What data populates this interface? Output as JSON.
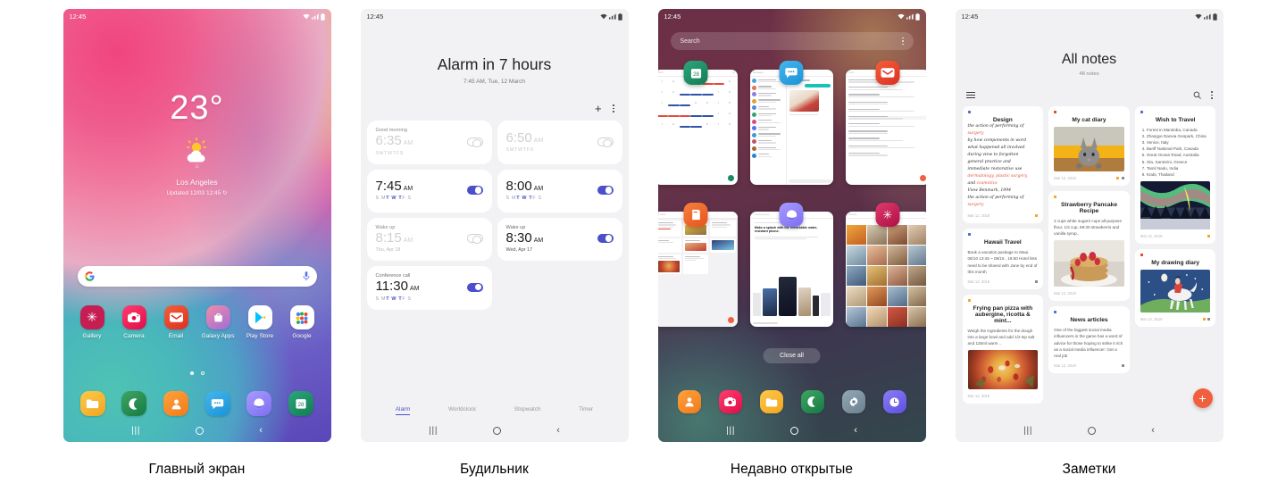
{
  "panels": [
    {
      "caption": "Главный экран"
    },
    {
      "caption": "Будильник"
    },
    {
      "caption": "Недавно открытые"
    },
    {
      "caption": "Заметки"
    }
  ],
  "status": {
    "time": "12:45"
  },
  "home": {
    "weather": {
      "temp": "23°",
      "pin": "⌂",
      "city": "Los Angeles",
      "updated": "Updated 12/03 12:45 ↻"
    },
    "search": {
      "placeholder": "",
      "logo": "G",
      "mic": "mic-icon"
    },
    "apps": [
      {
        "label": "Gallery",
        "glyph": "✳",
        "color": "#c51e53"
      },
      {
        "label": "Camera",
        "glyph": "◉",
        "color": "#e81c4f"
      },
      {
        "label": "Email",
        "glyph": "✉",
        "color": "#e8462c"
      },
      {
        "label": "Galaxy Apps",
        "glyph": "⬤",
        "color": "#e05a86"
      },
      {
        "label": "Play Store",
        "glyph": "▶",
        "color": "#ffffff"
      },
      {
        "label": "Google",
        "glyph": "⋮⋮",
        "color": "#ffffff"
      }
    ],
    "dots": {
      "active": 0,
      "count": 2
    },
    "dock": [
      {
        "label": "My Files",
        "glyph": "▭",
        "color": "#f5b431"
      },
      {
        "label": "Phone",
        "glyph": "✆",
        "color": "#2f8a4e"
      },
      {
        "label": "Contacts",
        "glyph": "●",
        "color": "#f08a2c"
      },
      {
        "label": "Messages",
        "glyph": "⋯",
        "color": "#2ba3dd"
      },
      {
        "label": "Internet",
        "glyph": "◓",
        "color": "#8d7cf0"
      },
      {
        "label": "Calendar",
        "glyph": "28",
        "color": "#1a8a62"
      }
    ],
    "nav": {
      "recents": "|||",
      "home": "home-circle",
      "back": "‹"
    }
  },
  "alarm": {
    "headline": "Alarm in 7 hours",
    "subhead": "7:45 AM, Tue, 12 March",
    "add_label": "+",
    "more_label": "more-options",
    "items": [
      {
        "label": "Good morning",
        "time": "6:35",
        "ampm": "AM",
        "days": "SMTWTFS",
        "active_days": "",
        "date": "",
        "on": false
      },
      {
        "label": "",
        "time": "6:50",
        "ampm": "AM",
        "days": "SMTWTFS",
        "active_days": "TWT",
        "date": "",
        "on": false
      },
      {
        "label": "",
        "time": "7:45",
        "ampm": "AM",
        "days": "SMTWTFS",
        "active_days": "TWT",
        "date": "",
        "on": true
      },
      {
        "label": "",
        "time": "8:00",
        "ampm": "AM",
        "days": "SMTWTFS",
        "active_days": "TWT",
        "date": "",
        "on": true
      },
      {
        "label": "Wake up",
        "time": "8:15",
        "ampm": "AM",
        "days": "",
        "active_days": "",
        "date": "Thu, Apr 18",
        "on": false
      },
      {
        "label": "Wake up",
        "time": "8:30",
        "ampm": "AM",
        "days": "",
        "active_days": "",
        "date": "Wed, Apr 17",
        "on": true
      },
      {
        "label": "Conference call",
        "time": "11:30",
        "ampm": "AM",
        "days": "SMTWTFS",
        "active_days": "TWT",
        "date": "",
        "on": true
      }
    ],
    "tabs": [
      {
        "label": "Alarm",
        "active": true
      },
      {
        "label": "Worldclock",
        "active": false
      },
      {
        "label": "Stopwatch",
        "active": false
      },
      {
        "label": "Timer",
        "active": false
      }
    ]
  },
  "recents": {
    "search_placeholder": "Search",
    "more_label": "more-options",
    "close_all": "Close all",
    "cards": [
      {
        "app": "Calendar",
        "glyph": "28",
        "color": "#1a8a62",
        "kind": "calendar"
      },
      {
        "app": "Messages",
        "glyph": "⋯",
        "color": "#2ba3dd",
        "kind": "messages"
      },
      {
        "app": "Email",
        "glyph": "✉",
        "color": "#e8462c",
        "kind": "email"
      },
      {
        "app": "Notes",
        "glyph": "▮",
        "color": "#ef6a29",
        "kind": "notes"
      },
      {
        "app": "Internet",
        "glyph": "◓",
        "color": "#8d7cf0",
        "kind": "web"
      },
      {
        "app": "Gallery",
        "glyph": "✳",
        "color": "#c51e53",
        "kind": "gallery"
      }
    ],
    "web_headline": "Make a splash with the remarkable water-resistant phone.",
    "dock": [
      {
        "label": "Contacts",
        "glyph": "●",
        "color": "#f08a2c"
      },
      {
        "label": "Camera",
        "glyph": "◉",
        "color": "#e81c4f"
      },
      {
        "label": "My Files",
        "glyph": "▭",
        "color": "#f5b431"
      },
      {
        "label": "Phone",
        "glyph": "✆",
        "color": "#2f8a4e"
      },
      {
        "label": "Settings",
        "glyph": "✿",
        "color": "#7c93a0"
      },
      {
        "label": "Clock",
        "glyph": "◴",
        "color": "#6f63e0"
      }
    ]
  },
  "notes": {
    "title": "All notes",
    "count": "48 notes",
    "menu_label": "navigation-drawer",
    "search_label": "search",
    "more_label": "more-options",
    "fab_label": "+",
    "columns": [
      [
        {
          "pin": "#4b6fe0",
          "title": "Design",
          "kind": "handwriting",
          "date": "Mar 12, 2019",
          "marks": [
            "#f5a623"
          ],
          "lines": [
            {
              "t": "the action of performing of",
              "r": "surgery"
            },
            {
              "t": "by how components in word",
              "r": ""
            },
            {
              "t": "what happened all involved",
              "r": ""
            },
            {
              "t": "during view to forgotten",
              "r": ""
            },
            {
              "t": "general practice and",
              "r": ""
            },
            {
              "t": "immediate restorative use",
              "r": ""
            },
            {
              "t": "",
              "r": "dermatology, plastic surgery,"
            },
            {
              "t": "and",
              "r": "cosmetics"
            },
            {
              "t": "       View Benmark, 1994",
              "r": ""
            },
            {
              "t": "the action of performing of",
              "r": "surgery"
            }
          ]
        },
        {
          "pin": "#4b6fe0",
          "title": "Hawaii Travel",
          "kind": "text",
          "date": "Mar 12, 2019",
          "marks": [
            "#8a8a8a"
          ],
          "body": "Book a vacation package to Maui. 08/10 13:45 ~ 08/15 , 19:50 Hotel lists need to be shared with Jane by end of this month"
        },
        {
          "pin": "#f5a623",
          "title": "Frying pan pizza with aubergine, ricotta & mint...",
          "kind": "text-image",
          "date": "Mar 12, 2019",
          "marks": [],
          "body": "Weigh the ingredients for the dough into a large bowl and add 1/2 tsp salt and 125ml warm ..",
          "image": "pizza"
        }
      ],
      [
        {
          "pin": "#e8462c",
          "title": "My cat diary",
          "kind": "image",
          "date": "Mar 12, 2019",
          "marks": [
            "#f5a623",
            "#8a8a8a"
          ],
          "image": "cat"
        },
        {
          "pin": "#f5a623",
          "title": "Strawberry Pancake Recipe",
          "kind": "text-image",
          "date": "Mar 12, 2019",
          "marks": [],
          "body": "2 cups white sugar2 cups all-purpose flour, 1/2 cup, 69:30 strawberris and vanilla syrup..",
          "image": "pancake"
        },
        {
          "pin": "#4b6fe0",
          "title": "News articles",
          "kind": "text",
          "date": "Mar 12, 2019",
          "marks": [
            "#8a8a8a"
          ],
          "body": "One of the biggest social media influencers in the game has a word of advice for those hoping to strike it rich as a social media influencer: Get a real job"
        }
      ],
      [
        {
          "pin": "#4b6fe0",
          "title": "Wish to Travel",
          "kind": "list-image",
          "date": "Mar 12, 2019",
          "marks": [
            "#f5a623"
          ],
          "list": [
            "Forest in Manitoba, Canada",
            "Zhangye Danxia Geopark, China",
            "Venice, Italy",
            "Banff National Park, Canada",
            "Great Ocean Road, Australia",
            "Oia, Santorini, Greece",
            "Tamil Nadu, India",
            "Krabi, Thailand"
          ],
          "image": "aurora"
        },
        {
          "pin": "#e8462c",
          "title": "My drawing diary",
          "kind": "image",
          "date": "Mar 12, 2019",
          "marks": [
            "#f5a623",
            "#8a8a8a"
          ],
          "image": "drawing"
        }
      ]
    ]
  }
}
